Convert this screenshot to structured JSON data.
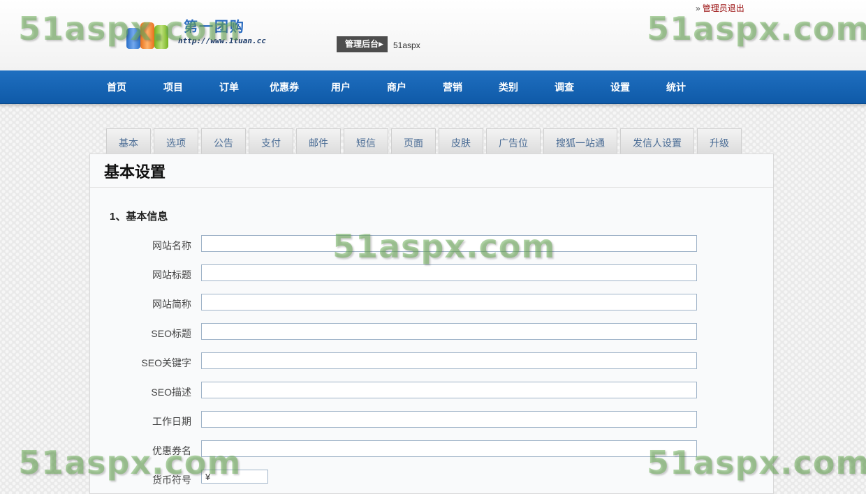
{
  "header": {
    "logo_brand": "第一团购",
    "logo_url": "http://www.1tuan.cc",
    "admin_label": "管理后台",
    "site_name": "51aspx",
    "logout_prefix": "»",
    "logout_label": "管理员退出"
  },
  "nav": {
    "items": [
      "首页",
      "项目",
      "订单",
      "优惠券",
      "用户",
      "商户",
      "营销",
      "类别",
      "调查",
      "设置",
      "统计"
    ]
  },
  "tabs": [
    "基本",
    "选项",
    "公告",
    "支付",
    "邮件",
    "短信",
    "页面",
    "皮肤",
    "广告位",
    "搜狐一站通",
    "发信人设置",
    "升级"
  ],
  "panel": {
    "title": "基本设置",
    "section_title": "1、基本信息",
    "fields": [
      {
        "label": "网站名称",
        "value": ""
      },
      {
        "label": "网站标题",
        "value": ""
      },
      {
        "label": "网站简称",
        "value": ""
      },
      {
        "label": "SEO标题",
        "value": ""
      },
      {
        "label": "SEO关键字",
        "value": ""
      },
      {
        "label": "SEO描述",
        "value": ""
      },
      {
        "label": "工作日期",
        "value": ""
      },
      {
        "label": "优惠券名",
        "value": ""
      },
      {
        "label": "货币符号",
        "value": "¥"
      }
    ]
  },
  "watermark": "51aspx.com",
  "colors": {
    "nav_blue": "#1565b8",
    "tab_text": "#4a6c95",
    "input_border": "#9fb3c8",
    "logout_red": "#9a1010"
  }
}
